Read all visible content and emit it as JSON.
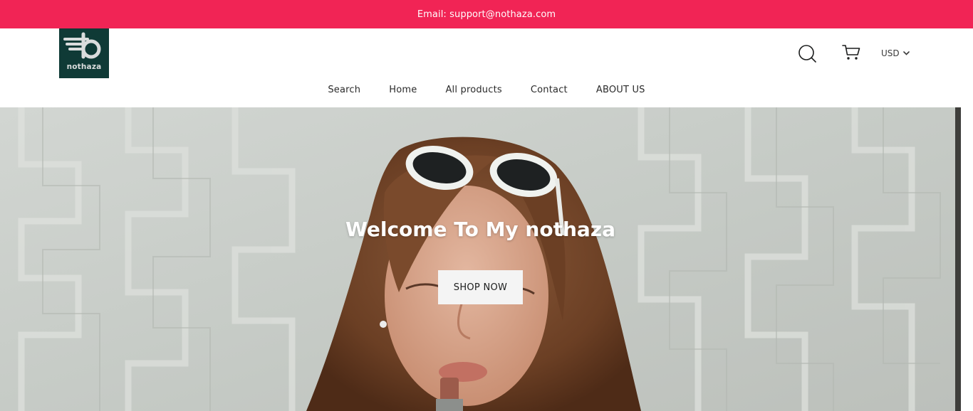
{
  "announcement": {
    "text": "Email: support@nothaza.com"
  },
  "header": {
    "logo": {
      "text": "nothaza",
      "icon": "nothaza-logo-icon"
    },
    "icons": {
      "search": "search-icon",
      "cart": "cart-icon"
    },
    "currency": {
      "value": "USD",
      "icon": "chevron-down-icon"
    }
  },
  "nav": [
    {
      "label": "Search"
    },
    {
      "label": "Home"
    },
    {
      "label": "All products"
    },
    {
      "label": "Contact"
    },
    {
      "label": "ABOUT US"
    }
  ],
  "hero": {
    "title": "Welcome To My nothaza",
    "button_label": "SHOP NOW"
  },
  "colors": {
    "announcement_bg": "#f12455",
    "logo_bg": "#0f3a36",
    "button_bg": "#f4f4f4"
  }
}
